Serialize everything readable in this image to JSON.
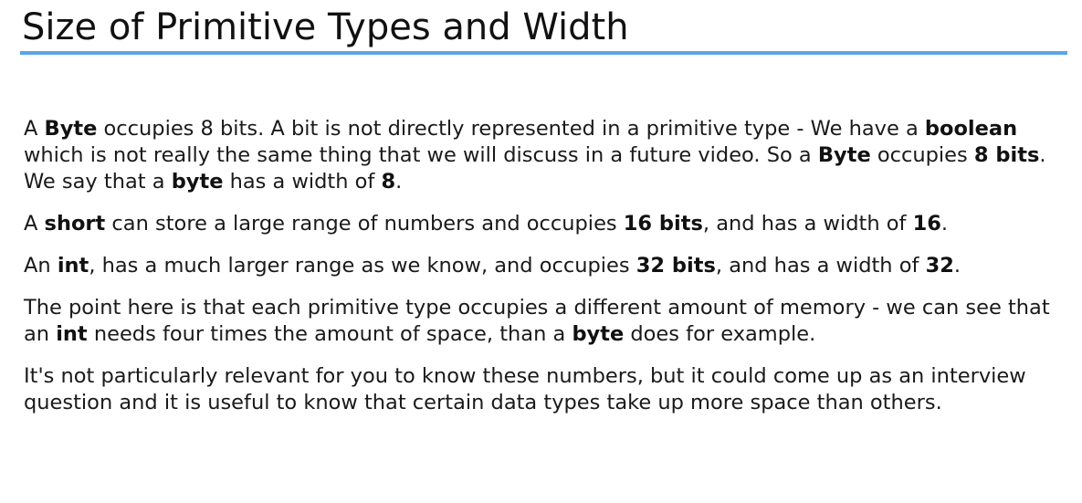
{
  "slide": {
    "title": "Size of Primitive Types and Width",
    "accent_color": "#5aa5e6"
  },
  "paragraphs": [
    {
      "segments": [
        {
          "text": "A ",
          "bold": false
        },
        {
          "text": "Byte",
          "bold": true
        },
        {
          "text": " occupies 8 bits. A bit is not directly represented in a primitive type - We have a ",
          "bold": false
        },
        {
          "text": "boolean",
          "bold": true
        },
        {
          "text": " which is not really the same thing that we will discuss in a future video. So a ",
          "bold": false
        },
        {
          "text": "Byte",
          "bold": true
        },
        {
          "text": " occupies ",
          "bold": false
        },
        {
          "text": "8 bits",
          "bold": true
        },
        {
          "text": ". We say that a ",
          "bold": false
        },
        {
          "text": "byte",
          "bold": true
        },
        {
          "text": " has a width of ",
          "bold": false
        },
        {
          "text": "8",
          "bold": true
        },
        {
          "text": ".",
          "bold": false
        }
      ]
    },
    {
      "segments": [
        {
          "text": "A ",
          "bold": false
        },
        {
          "text": "short",
          "bold": true
        },
        {
          "text": " can store a large range of numbers and occupies ",
          "bold": false
        },
        {
          "text": "16 bits",
          "bold": true
        },
        {
          "text": ", and has a width of ",
          "bold": false
        },
        {
          "text": "16",
          "bold": true
        },
        {
          "text": ".",
          "bold": false
        }
      ]
    },
    {
      "segments": [
        {
          "text": "An ",
          "bold": false
        },
        {
          "text": "int",
          "bold": true
        },
        {
          "text": ", has a much larger range as we know, and occupies ",
          "bold": false
        },
        {
          "text": "32 bits",
          "bold": true
        },
        {
          "text": ", and has a width of ",
          "bold": false
        },
        {
          "text": "32",
          "bold": true
        },
        {
          "text": ".",
          "bold": false
        }
      ]
    },
    {
      "segments": [
        {
          "text": "The point here is that each primitive type occupies a different amount of memory - we can see that an ",
          "bold": false
        },
        {
          "text": "int",
          "bold": true
        },
        {
          "text": " needs four times the amount of space, than a ",
          "bold": false
        },
        {
          "text": "byte",
          "bold": true
        },
        {
          "text": " does for example.",
          "bold": false
        }
      ]
    },
    {
      "segments": [
        {
          "text": "It's not particularly relevant for you to know these numbers, but it could come up as an interview question and it is useful to know that certain data types take up more space than others.",
          "bold": false
        }
      ]
    }
  ]
}
